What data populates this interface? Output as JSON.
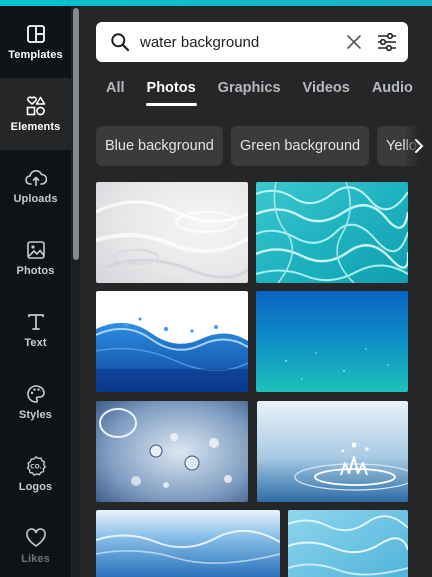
{
  "sidebar": {
    "items": [
      {
        "label": "Templates",
        "icon": "layout-icon",
        "active": false
      },
      {
        "label": "Elements",
        "icon": "shapes-icon",
        "active": true
      },
      {
        "label": "Uploads",
        "icon": "cloud-upload-icon",
        "active": false
      },
      {
        "label": "Photos",
        "icon": "image-icon",
        "active": false
      },
      {
        "label": "Text",
        "icon": "text-icon",
        "active": false
      },
      {
        "label": "Styles",
        "icon": "palette-icon",
        "active": false
      },
      {
        "label": "Logos",
        "icon": "logo-badge-icon",
        "active": false
      },
      {
        "label": "Likes",
        "icon": "heart-icon",
        "active": false
      }
    ]
  },
  "search": {
    "value": "water background",
    "icon": "search-icon",
    "clear_icon": "close-icon",
    "filter_icon": "sliders-icon"
  },
  "tabs": [
    {
      "label": "All",
      "active": false
    },
    {
      "label": "Photos",
      "active": true
    },
    {
      "label": "Graphics",
      "active": false
    },
    {
      "label": "Videos",
      "active": false
    },
    {
      "label": "Audio",
      "active": false
    }
  ],
  "chips": [
    {
      "label": "Blue background"
    },
    {
      "label": "Green background"
    },
    {
      "label": "Yellow background"
    }
  ],
  "chip_next_icon": "chevron-right-icon",
  "results": [
    {
      "kind": "white-water-ripples"
    },
    {
      "kind": "turquoise-pool-caustics"
    },
    {
      "kind": "blue-water-wave"
    },
    {
      "kind": "blue-gradient-sea"
    },
    {
      "kind": "water-bubbles-closeup"
    },
    {
      "kind": "water-drop-splash"
    },
    {
      "kind": "underwater-surface"
    },
    {
      "kind": "light-blue-caustics"
    }
  ],
  "colors": {
    "accent": "#00c4cc",
    "rail_bg": "#0e1318",
    "panel_bg": "#252627",
    "chip_bg": "#3a3b3d"
  }
}
